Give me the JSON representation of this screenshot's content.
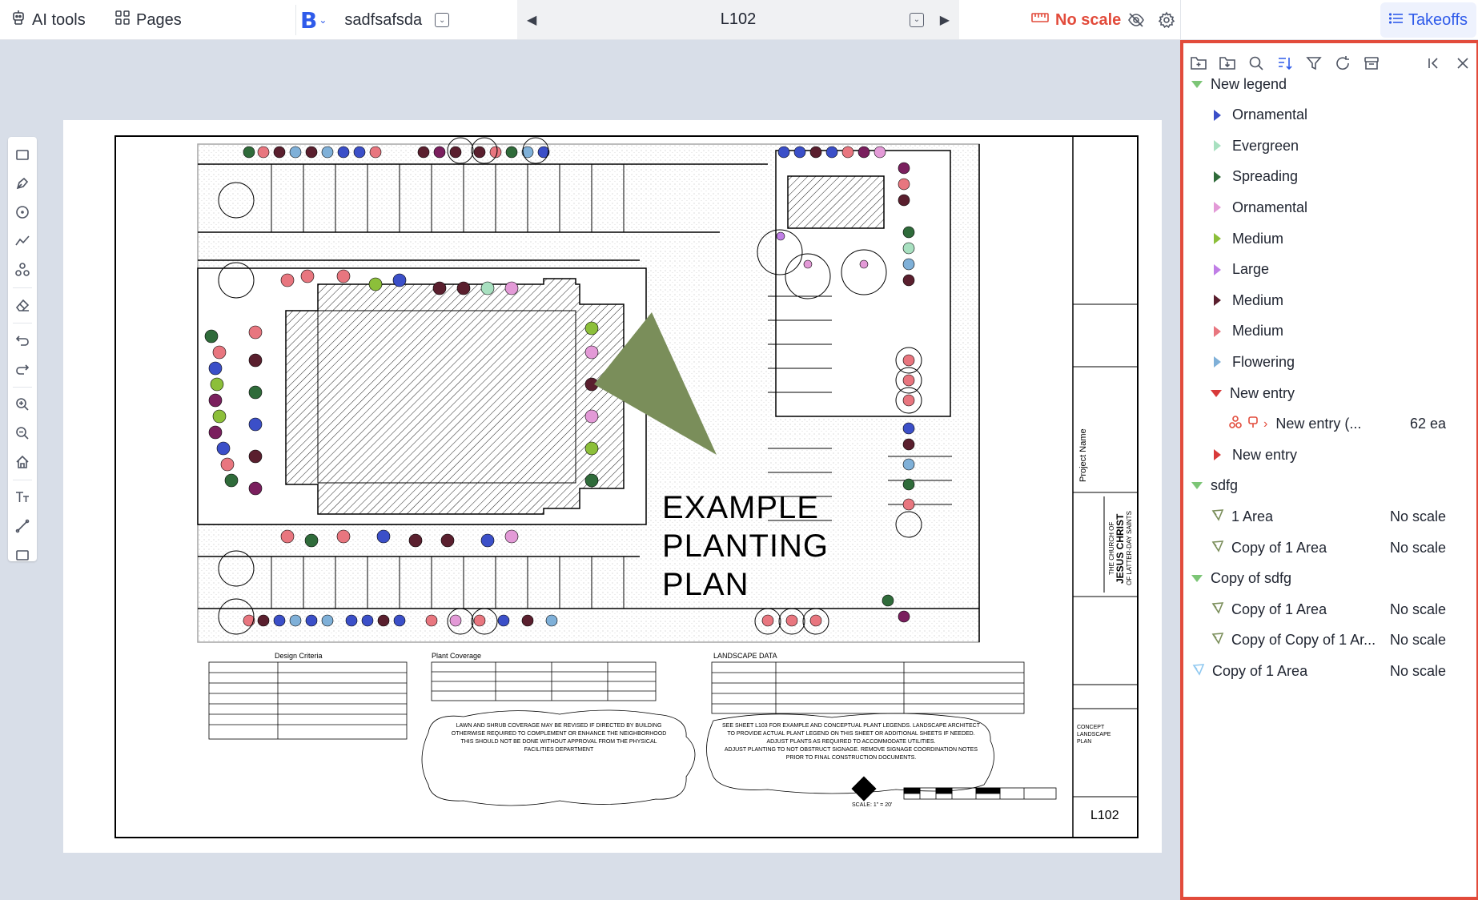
{
  "topbar": {
    "ai_tools_label": "AI tools",
    "pages_label": "Pages",
    "doc_logo": "B",
    "doc_name": "sadfsafsda",
    "page_label": "L102",
    "scale_label": "No scale",
    "takeoffs_label": "Takeoffs",
    "icons": [
      "robot-icon",
      "grid-icon",
      "chevron-down-icon",
      "caret-left-icon",
      "caret-right-icon",
      "ruler-icon",
      "eye-off-icon",
      "gear-icon",
      "list-icon"
    ]
  },
  "left_tools": [
    "rectangle-tool-icon",
    "pen-tool-icon",
    "circle-tool-icon",
    "polyline-tool-icon",
    "count-tool-icon",
    "eraser-icon",
    "undo-icon",
    "redo-icon",
    "zoom-in-icon",
    "zoom-out-icon",
    "home-icon",
    "text-tool-icon",
    "measure-tool-icon",
    "frame-tool-icon"
  ],
  "sheet": {
    "title_lines": [
      "EXAMPLE",
      "PLANTING",
      "PLAN"
    ],
    "project_name_label": "Project Name",
    "church_lines": [
      "THE CHURCH OF",
      "JESUS CHRIST",
      "OF LATTER-DAY SAINTS"
    ],
    "sheet_title_lines": [
      "CONCEPT",
      "LANDSCAPE",
      "PLAN"
    ],
    "sheet_number": "L102",
    "design_criteria_heading": "Design Criteria",
    "plant_coverage_heading": "Plant Coverage",
    "landscape_data_heading": "LANDSCAPE DATA",
    "note_left_lines": [
      "LAWN AND SHRUB COVERAGE MAY BE REVISED IF DIRECTED BY BUILDING",
      "OTHERWISE REQUIRED TO COMPLEMENT OR ENHANCE THE NEIGHBORHOOD",
      "THIS SHOULD NOT BE DONE WITHOUT APPROVAL FROM THE PHYSICAL",
      "FACILITIES DEPARTMENT"
    ],
    "note_right_lines": [
      "SEE SHEET L103 FOR EXAMPLE AND CONCEPTUAL PLANT LEGENDS. LANDSCAPE ARCHITECT",
      "TO PROVIDE ACTUAL PLANT LEGEND ON THIS SHEET OR ADDITIONAL SHEETS IF NEEDED.",
      "ADJUST PLANTS AS REQUIRED TO ACCOMMODATE UTILITIES.",
      "ADJUST PLANTING TO NOT OBSTRUCT SIGNAGE. REMOVE SIGNAGE COORDINATION NOTES",
      "PRIOR TO FINAL CONSTRUCTION DOCUMENTS."
    ],
    "scale_text": "SCALE: 1\" = 20'"
  },
  "panel": {
    "toolbar_icons": [
      "add-folder-icon",
      "import-folder-icon",
      "search-icon",
      "sort-icon",
      "filter-icon",
      "refresh-icon",
      "archive-icon",
      "collapse-panel-icon",
      "close-icon"
    ],
    "rows": [
      {
        "label": "New legend",
        "level": 0,
        "arrow": "down",
        "color": "#7cc576",
        "value": ""
      },
      {
        "label": "Ornamental",
        "level": 1,
        "arrow": "right",
        "color": "#3b4fc8",
        "value": ""
      },
      {
        "label": "Evergreen",
        "level": 1,
        "arrow": "right",
        "color": "#a8e0c0",
        "value": ""
      },
      {
        "label": "Spreading",
        "level": 1,
        "arrow": "right",
        "color": "#2f6b3a",
        "value": ""
      },
      {
        "label": "Ornamental",
        "level": 1,
        "arrow": "right",
        "color": "#e39ad7",
        "value": ""
      },
      {
        "label": "Medium",
        "level": 1,
        "arrow": "right",
        "color": "#8cbf3a",
        "value": ""
      },
      {
        "label": "Large",
        "level": 1,
        "arrow": "right",
        "color": "#c07ee6",
        "value": ""
      },
      {
        "label": "Medium",
        "level": 1,
        "arrow": "right",
        "color": "#5a1f2e",
        "value": ""
      },
      {
        "label": "Medium",
        "level": 1,
        "arrow": "right",
        "color": "#e8767f",
        "value": ""
      },
      {
        "label": "Flowering",
        "level": 1,
        "arrow": "right",
        "color": "#7fb0d8",
        "value": ""
      },
      {
        "label": "New entry",
        "level": 1,
        "arrow": "down",
        "color": "#d83a3a",
        "value": ""
      },
      {
        "label": "New entry (...",
        "level": 2,
        "arrow": "none",
        "color": "#e24b3b",
        "value": "62 ea"
      },
      {
        "label": "New entry",
        "level": 1,
        "arrow": "right",
        "color": "#d83a3a",
        "value": ""
      },
      {
        "label": "sdfg",
        "level": 0,
        "arrow": "down",
        "color": "#7cc576",
        "value": ""
      },
      {
        "label": "1 Area",
        "level": 1,
        "arrow": "area",
        "color": "#7a8e5a",
        "value": "No scale"
      },
      {
        "label": "Copy of 1 Area",
        "level": 1,
        "arrow": "area",
        "color": "#7a8e5a",
        "value": "No scale"
      },
      {
        "label": "Copy of sdfg",
        "level": 0,
        "arrow": "down",
        "color": "#7cc576",
        "value": ""
      },
      {
        "label": "Copy of 1 Area",
        "level": 1,
        "arrow": "area",
        "color": "#7a8e5a",
        "value": "No scale"
      },
      {
        "label": "Copy of Copy of 1 Ar...",
        "level": 1,
        "arrow": "area",
        "color": "#7a8e5a",
        "value": "No scale"
      },
      {
        "label": "Copy of 1 Area",
        "level": 0,
        "arrow": "area",
        "color": "#8fc8f0",
        "value": "No scale"
      }
    ]
  },
  "colors": {
    "accent": "#2f5bea",
    "alert": "#e24b3b",
    "triangle": "#7a8e5a"
  }
}
